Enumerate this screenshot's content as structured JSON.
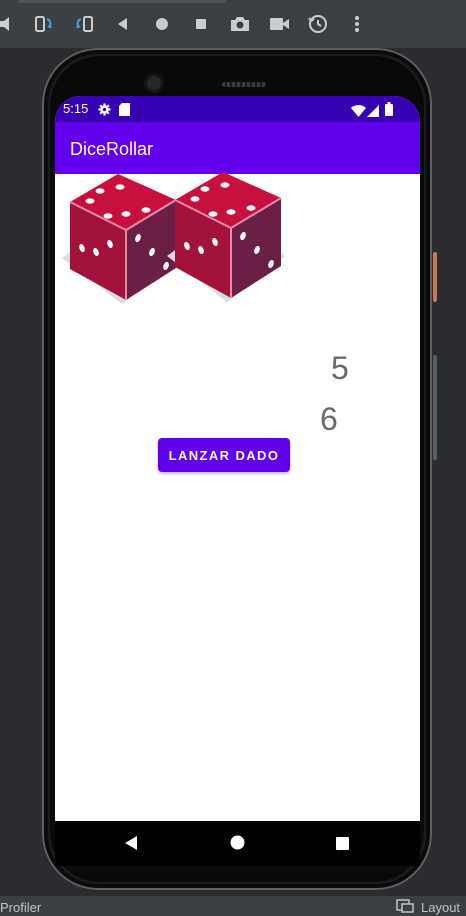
{
  "ide": {
    "toolbar_icons": [
      "volume-icon",
      "rotate-left-icon",
      "rotate-right-icon",
      "back-triangle-icon",
      "home-circle-icon",
      "overview-square-icon",
      "camera-icon",
      "video-icon",
      "snapshot-icon",
      "more-vert-icon"
    ],
    "bottom_left_label": "Profiler",
    "bottom_right_label": "Layout"
  },
  "device": {
    "status_bar": {
      "time": "5:15",
      "left_icons": [
        "settings-icon",
        "sd-card-icon"
      ],
      "right_icons": [
        "wifi-icon",
        "signal-icon",
        "battery-icon"
      ],
      "color": "#3700b3"
    },
    "app_bar": {
      "title": "DiceRollar",
      "color": "#6200ee"
    },
    "dice": [
      {
        "name": "die-1",
        "top_face": 5,
        "front_face": 6,
        "color": "#b3123f"
      },
      {
        "name": "die-2",
        "top_face": 5,
        "front_face": 6,
        "color": "#b3123f"
      }
    ],
    "results": {
      "first": "5",
      "second": "6"
    },
    "roll_button": {
      "label": "LANZAR DADO",
      "color": "#6200ee"
    },
    "nav_bar": [
      "back-icon",
      "home-icon",
      "recents-icon"
    ]
  }
}
